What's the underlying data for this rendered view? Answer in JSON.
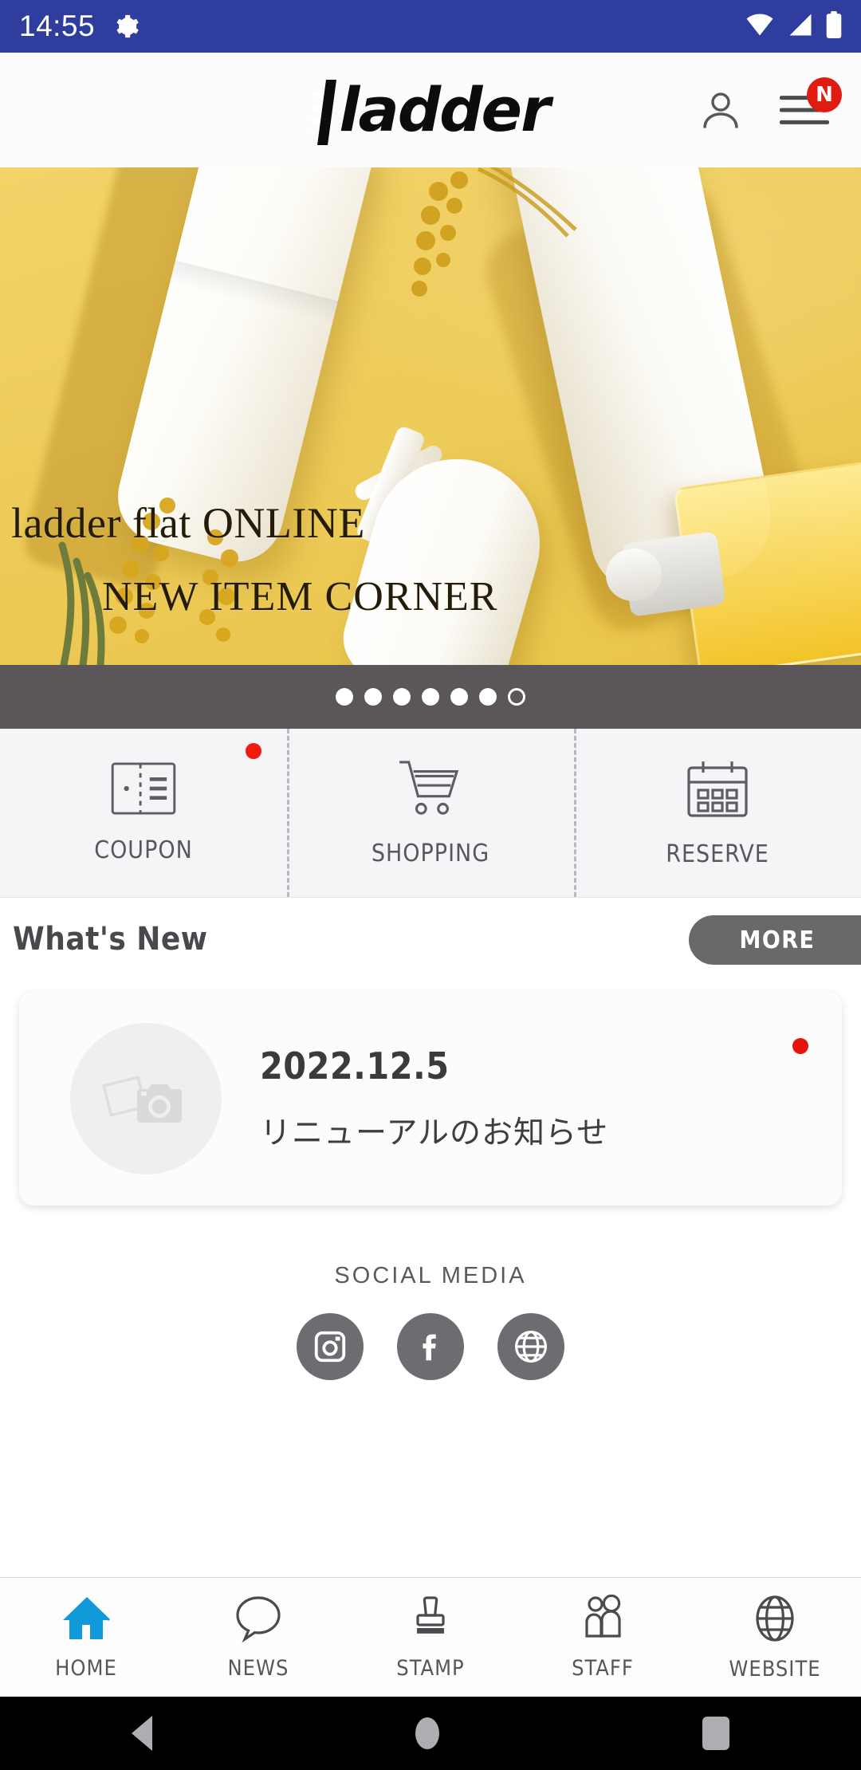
{
  "status_bar": {
    "time": "14:55",
    "gear_icon": "gear-icon",
    "wifi_icon": "wifi-icon",
    "signal_icon": "cellular-signal-icon",
    "battery_icon": "battery-icon",
    "background_color": "#2f3d9e"
  },
  "header": {
    "logo_text": "ladder",
    "account_icon": "person-icon",
    "menu_icon": "hamburger-menu-icon",
    "menu_badge": "N",
    "badge_color": "#e01b12"
  },
  "hero": {
    "line1": "ladder flat ONLINE",
    "line2": "NEW ITEM CORNER",
    "background_color": "#eecd5d",
    "carousel": {
      "total": 7,
      "active_index": 7,
      "bar_color": "#5a565a"
    }
  },
  "quick_actions": [
    {
      "label": "COUPON",
      "icon": "coupon-ticket-icon",
      "badge": true
    },
    {
      "label": "SHOPPING",
      "icon": "shopping-cart-icon",
      "badge": false
    },
    {
      "label": "RESERVE",
      "icon": "calendar-icon",
      "badge": false
    }
  ],
  "whats_new": {
    "title": "What's New",
    "more_label": "MORE",
    "more_color": "#6b686c",
    "items": [
      {
        "date": "2022.12.5",
        "title": "リニューアルのお知らせ",
        "thumbnail_icon": "photo-placeholder-icon",
        "unread": true
      }
    ]
  },
  "social": {
    "label": "SOCIAL MEDIA",
    "items": [
      {
        "name": "instagram-icon"
      },
      {
        "name": "facebook-icon"
      },
      {
        "name": "website-globe-icon"
      }
    ],
    "circle_color": "#6e6c71"
  },
  "bottom_nav": {
    "active": "HOME",
    "active_color": "#119ada",
    "items": [
      {
        "label": "HOME",
        "icon": "home-icon"
      },
      {
        "label": "NEWS",
        "icon": "speech-bubble-icon"
      },
      {
        "label": "STAMP",
        "icon": "stamp-icon"
      },
      {
        "label": "STAFF",
        "icon": "people-icon"
      },
      {
        "label": "WEBSITE",
        "icon": "globe-icon"
      }
    ]
  },
  "android_nav": {
    "back": "back-icon",
    "home": "home-circle-icon",
    "recents": "recents-icon"
  }
}
